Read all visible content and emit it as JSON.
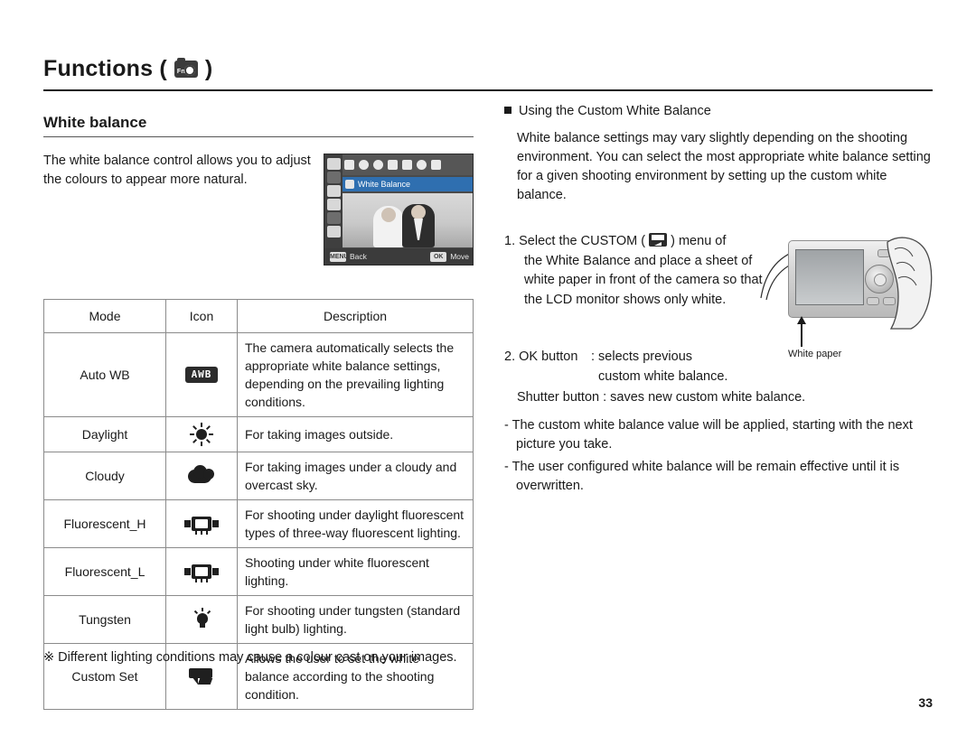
{
  "header": {
    "title": "Functions (",
    "title_close": ")",
    "icon": "camera-icon"
  },
  "left": {
    "section_title": "White balance",
    "intro": "The white balance control allows you to adjust the colours to appear more natural.",
    "lcd": {
      "menu_label": "White Balance",
      "back_key": "MENU",
      "back_label": "Back",
      "move_key": "OK",
      "move_label": "Move"
    },
    "table": {
      "headers": [
        "Mode",
        "Icon",
        "Description"
      ],
      "rows": [
        {
          "mode": "Auto WB",
          "icon": "awb-icon",
          "icon_text": "AWB",
          "description": "The camera automatically selects the appropriate white balance settings, depending on the prevailing lighting conditions."
        },
        {
          "mode": "Daylight",
          "icon": "sun-icon",
          "icon_text": "",
          "description": "For taking images outside."
        },
        {
          "mode": "Cloudy",
          "icon": "cloud-icon",
          "icon_text": "",
          "description": "For taking images under a cloudy and overcast sky."
        },
        {
          "mode": "Fluorescent_H",
          "icon": "fluorescent-h-icon",
          "icon_text": "",
          "description": "For shooting under daylight fluorescent types of three-way fluorescent lighting."
        },
        {
          "mode": "Fluorescent_L",
          "icon": "fluorescent-l-icon",
          "icon_text": "",
          "description": "Shooting under white fluorescent lighting."
        },
        {
          "mode": "Tungsten",
          "icon": "tungsten-bulb-icon",
          "icon_text": "",
          "description": "For shooting under tungsten (standard light bulb) lighting."
        },
        {
          "mode": "Custom Set",
          "icon": "custom-set-icon",
          "icon_text": "",
          "description": "Allows the user to set the white balance according to the shooting condition."
        }
      ]
    },
    "footnote": "※ Different lighting conditions may cause a colour cast on your images."
  },
  "right": {
    "bullet_heading": "Using the Custom White Balance",
    "paragraph": "White balance settings may vary slightly depending on the shooting environment. You can select the most appropriate white balance setting for a given shooting environment by setting up the custom white balance.",
    "step1_a": "1. Select the CUSTOM (",
    "step1_b": ") menu of",
    "step1_rest": "the White Balance and place a sheet of white paper in front of the camera so that the LCD monitor shows only white.",
    "step2_label": "2. OK button",
    "step2_value": ": selects previous",
    "step2_value2": "custom white balance.",
    "shutter_line": "Shutter button : saves new custom white balance.",
    "notes": [
      "- The custom white balance value will be applied, starting with the next picture you take.",
      "- The user configured white balance will be remain effective until it is overwritten."
    ],
    "camera_caption": "White paper"
  },
  "page_number": "33",
  "colors": {
    "accent_blue": "#2f6fb0",
    "rule": "#1a1a1a"
  }
}
